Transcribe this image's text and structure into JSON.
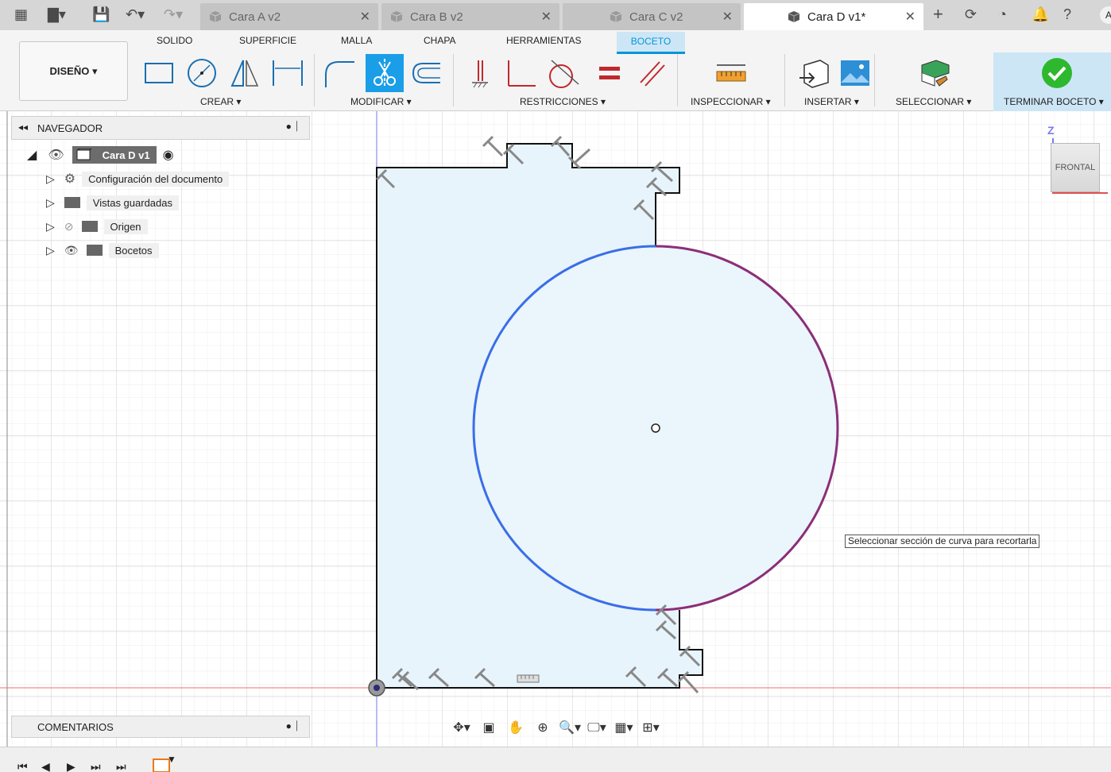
{
  "tabs": [
    {
      "label": "Cara A v2"
    },
    {
      "label": "Cara B v2"
    },
    {
      "label": "Cara C v2"
    },
    {
      "label": "Cara D v1*"
    }
  ],
  "user_initial": "A",
  "ribbon": {
    "tabs": [
      "SOLIDO",
      "SUPERFICIE",
      "MALLA",
      "CHAPA",
      "HERRAMIENTAS",
      "BOCETO"
    ],
    "design_label": "DISEÑO ▾",
    "groups": {
      "crear": "CREAR ▾",
      "modificar": "MODIFICAR ▾",
      "restricciones": "RESTRICCIONES ▾",
      "inspeccionar": "INSPECCIONAR ▾",
      "insertar": "INSERTAR ▾",
      "seleccionar": "SELECCIONAR ▾",
      "terminar": "TERMINAR BOCETO ▾"
    }
  },
  "navigator": {
    "title": "NAVEGADOR",
    "root": "Cara D v1",
    "items": [
      {
        "label": "Configuración del documento"
      },
      {
        "label": "Vistas guardadas"
      },
      {
        "label": "Origen"
      },
      {
        "label": "Bocetos"
      }
    ]
  },
  "comments_label": "COMENTARIOS",
  "tooltip": "Seleccionar sección de curva para recortarla",
  "viewcube": {
    "face": "FRONTAL",
    "axis": "Z"
  },
  "colors": {
    "accent": "#0696d7",
    "selected_tool": "#1a9ee8",
    "sketch_fill": "#e8f4fb",
    "circle_blue": "#3a6ee8",
    "circle_purple": "#8b2f78",
    "finish_green": "#2eb82e"
  }
}
